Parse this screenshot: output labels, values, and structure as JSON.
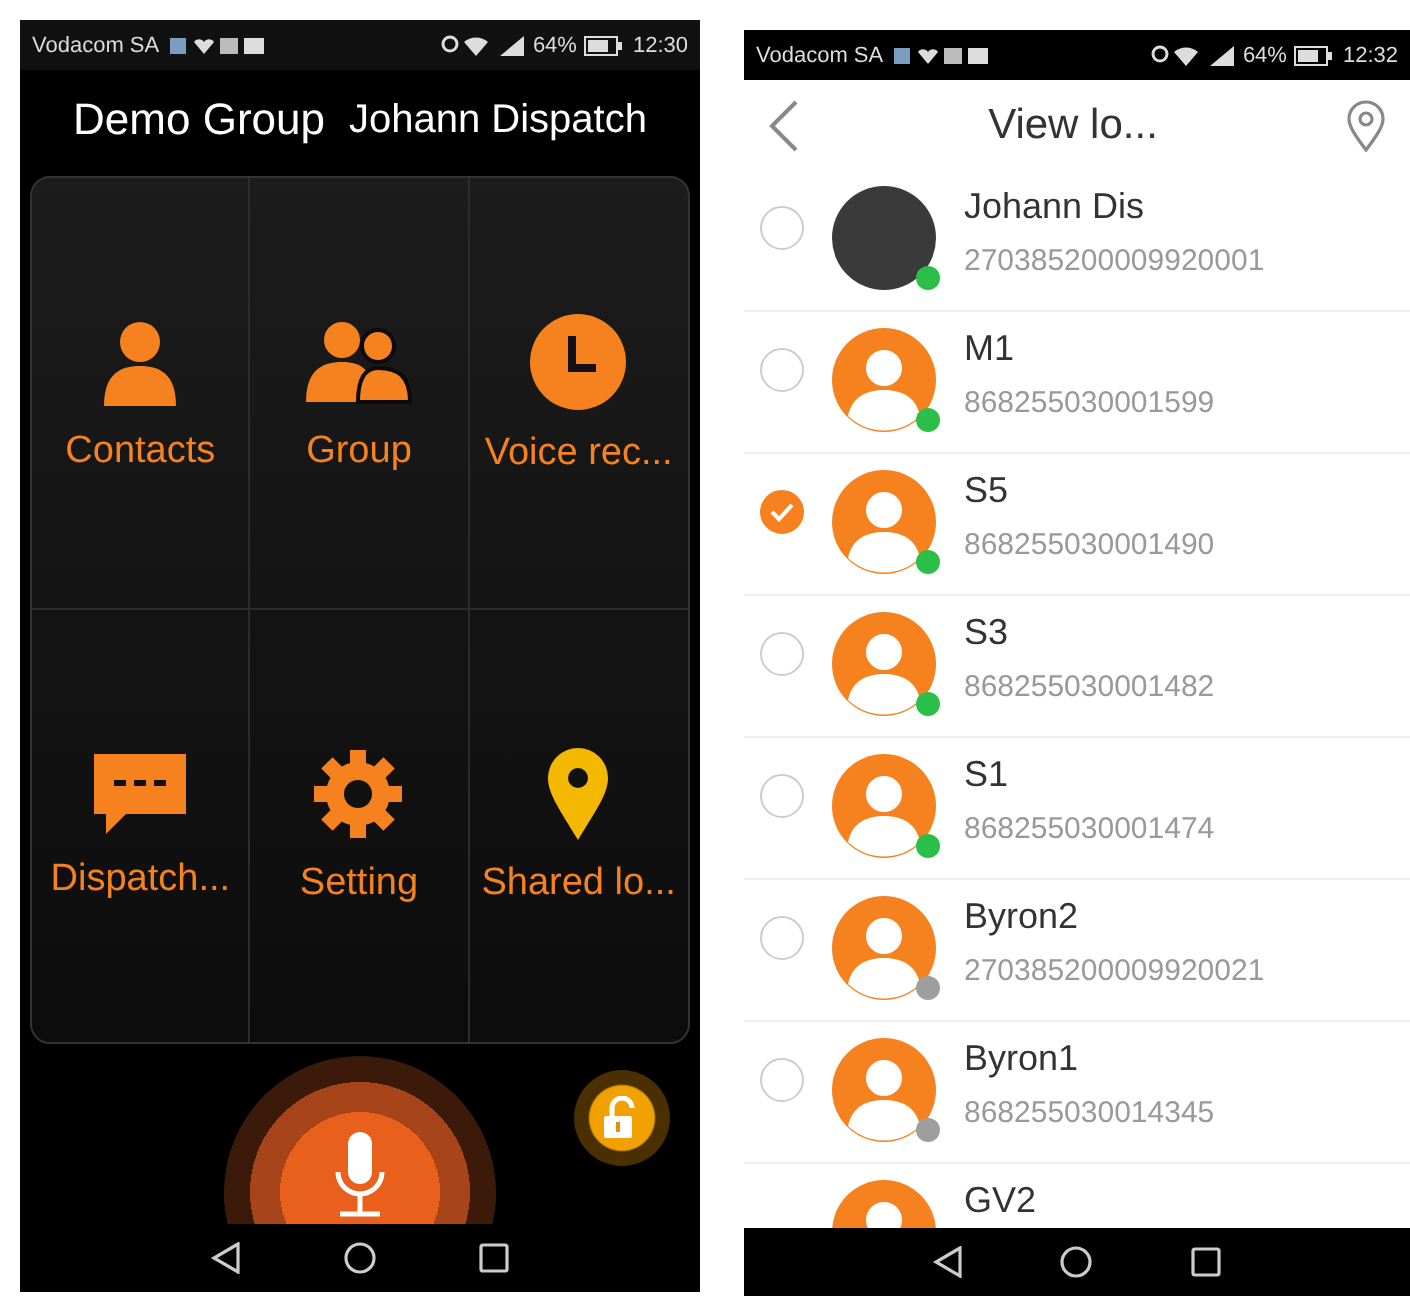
{
  "left_screen": {
    "status_bar": {
      "carrier": "Vodacom SA",
      "battery": "64%",
      "time": "12:30"
    },
    "header": {
      "group": "Demo Group",
      "user": "Johann Dispatch"
    },
    "tiles": [
      {
        "kind": "contacts",
        "label": "Contacts"
      },
      {
        "kind": "group",
        "label": "Group"
      },
      {
        "kind": "voice",
        "label": "Voice rec..."
      },
      {
        "kind": "dispatch",
        "label": "Dispatch..."
      },
      {
        "kind": "setting",
        "label": "Setting"
      },
      {
        "kind": "location",
        "label": "Shared lo..."
      }
    ]
  },
  "right_screen": {
    "status_bar": {
      "carrier": "Vodacom SA",
      "battery": "64%",
      "time": "12:32"
    },
    "header": {
      "title": "View lo..."
    },
    "contacts": [
      {
        "name": "Johann Dis",
        "number": "270385200009920001",
        "selected": false,
        "kind": "photo",
        "color": "#2bbf4a"
      },
      {
        "name": "M1",
        "number": "868255030001599",
        "selected": false,
        "kind": "default",
        "color": "#2bbf4a"
      },
      {
        "name": "S5",
        "number": "868255030001490",
        "selected": true,
        "kind": "default",
        "color": "#2bbf4a"
      },
      {
        "name": "S3",
        "number": "868255030001482",
        "selected": false,
        "kind": "default",
        "color": "#2bbf4a"
      },
      {
        "name": "S1",
        "number": "868255030001474",
        "selected": false,
        "kind": "default",
        "color": "#2bbf4a"
      },
      {
        "name": "Byron2",
        "number": "270385200009920021",
        "selected": false,
        "kind": "default",
        "color": "#9e9e9e"
      },
      {
        "name": "Byron1",
        "number": "868255030014345",
        "selected": false,
        "kind": "default",
        "color": "#9e9e9e"
      },
      {
        "name": "GV2",
        "kind": "default"
      }
    ]
  }
}
